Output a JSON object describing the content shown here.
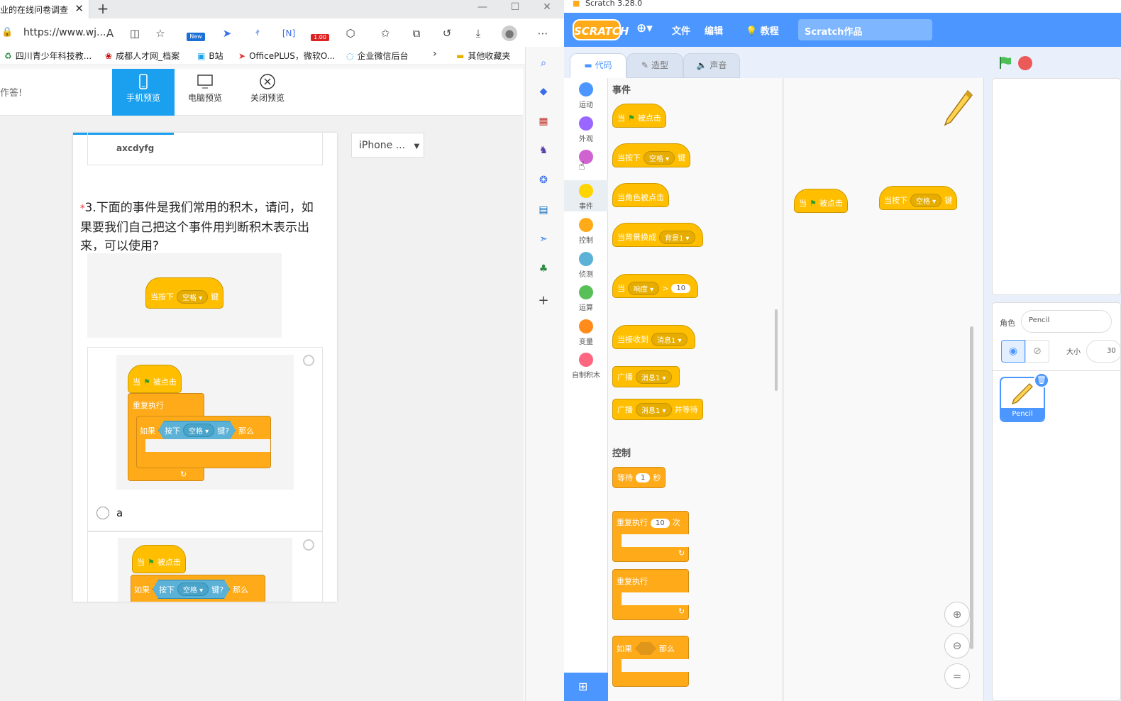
{
  "browser": {
    "tab_title": "业的在线问卷调查",
    "url": "https://www.wj...",
    "bookmarks": [
      "四川青少年科技教...",
      "成都人才网_档案",
      "B站",
      "OfficePLUS，微软O...",
      "企业微信后台",
      "其他收藏夹"
    ],
    "page": {
      "left_text": "作答!",
      "preview_buttons": [
        "手机预览",
        "电脑预览",
        "关闭预览"
      ],
      "device_select": "iPhone ...",
      "prev_option_text": "axcdyfg",
      "question_number": "3.",
      "question_text": "下面的事件是我们常用的积木，请问，如果要我们自己把这个事件用判断积木表示出来，可以使用?",
      "question_block": {
        "prefix": "当按下",
        "key": "空格",
        "suffix": "键"
      },
      "option1": {
        "label": "a",
        "hat": {
          "prefix": "当",
          "suffix": "被点击"
        },
        "forever": "重复执行",
        "if_block": {
          "if": "如果",
          "press": "按下",
          "key": "空格",
          "key_suffix": "键?",
          "then": "那么"
        }
      },
      "option2": {
        "hat": {
          "prefix": "当",
          "suffix": "被点击"
        },
        "if_block": {
          "if": "如果",
          "press": "按下",
          "key": "空格",
          "key_suffix": "键?",
          "then": "那么"
        }
      }
    },
    "new_badge": "New",
    "price_badge": "1.00"
  },
  "scratch": {
    "window_title": "Scratch 3.28.0",
    "logo": "SCRATCH",
    "menu": {
      "file": "文件",
      "edit": "编辑",
      "tutorials": "教程"
    },
    "project_name": "Scratch作品",
    "tabs": [
      "代码",
      "造型",
      "声音"
    ],
    "categories": [
      {
        "label": "运动",
        "color": "#4c97ff"
      },
      {
        "label": "外观",
        "color": "#9966ff"
      },
      {
        "label": "声音",
        "color": "#cf63cf"
      },
      {
        "label": "事件",
        "color": "#ffd500"
      },
      {
        "label": "控制",
        "color": "#ffab19"
      },
      {
        "label": "侦测",
        "color": "#5cb1d6"
      },
      {
        "label": "运算",
        "color": "#59c059"
      },
      {
        "label": "变量",
        "color": "#ff8c1a"
      },
      {
        "label": "自制积木",
        "color": "#ff6680"
      }
    ],
    "palette": {
      "events_header": "事件",
      "control_header": "控制",
      "blocks": {
        "flag_clicked": {
          "prefix": "当",
          "suffix": "被点击"
        },
        "key_pressed": {
          "prefix": "当按下",
          "key": "空格",
          "suffix": "键"
        },
        "sprite_clicked": "当角色被点击",
        "backdrop_switch": {
          "prefix": "当背景换成",
          "value": "背景1"
        },
        "greater": {
          "prefix": "当",
          "sensor": "响度",
          "op": ">",
          "value": "10"
        },
        "receive": {
          "prefix": "当接收到",
          "value": "消息1"
        },
        "broadcast": {
          "prefix": "广播",
          "value": "消息1"
        },
        "broadcast_wait": {
          "prefix": "广播",
          "value": "消息1",
          "suffix": "并等待"
        },
        "wait": {
          "prefix": "等待",
          "value": "1",
          "suffix": "秒"
        },
        "repeat": {
          "prefix": "重复执行",
          "value": "10",
          "suffix": "次"
        },
        "forever": "重复执行",
        "if_then": {
          "prefix": "如果",
          "suffix": "那么"
        }
      }
    },
    "workspace": {
      "block1": {
        "prefix": "当",
        "suffix": "被点击"
      },
      "block2": {
        "prefix": "当按下",
        "key": "空格",
        "suffix": "键"
      }
    },
    "sprite": {
      "label": "角色",
      "name": "Pencil",
      "size_label": "大小",
      "size": "30",
      "thumb_name": "Pencil"
    }
  }
}
